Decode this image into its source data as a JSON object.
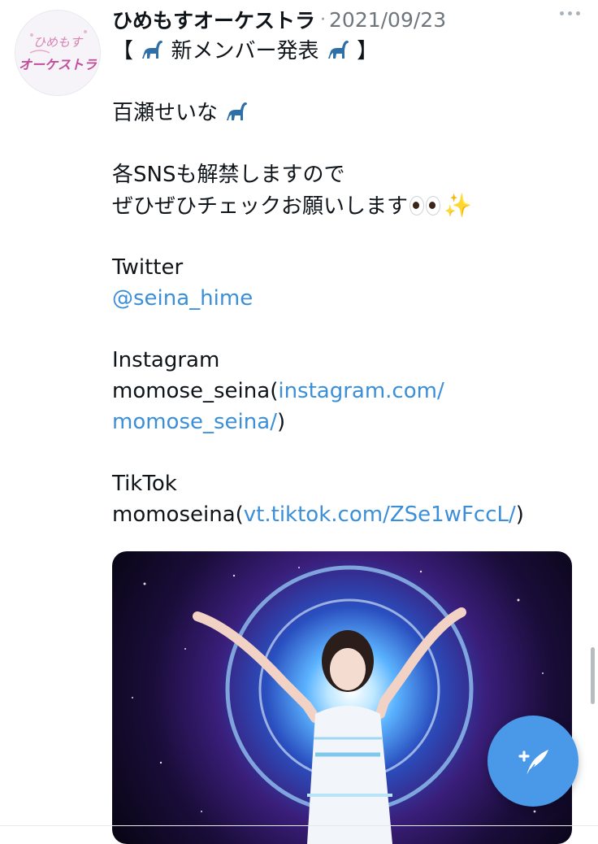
{
  "tweet": {
    "author_name": "ひめもすオーケストラ",
    "separator": "·",
    "date": "2021/09/23",
    "avatar_text": "ひめもす オーケストラ",
    "lines": {
      "title_pre": "【",
      "title": "新メンバー発表",
      "title_post": "】",
      "member": "百瀬せいな",
      "sns_line1": "各SNSも解禁しますので",
      "sns_line2": "ぜひぜひチェックお願いします",
      "twitter_label": "Twitter",
      "twitter_handle": "@seina_hime",
      "instagram_label": "Instagram",
      "instagram_user": "momose_seina(",
      "instagram_link1": "instagram.com/",
      "instagram_link2": "momose_seina/",
      "instagram_close": ")",
      "tiktok_label": "TikTok",
      "tiktok_user": "momoseina(",
      "tiktok_link": "vt.tiktok.com/ZSe1wFccL/",
      "tiktok_close": ")"
    }
  },
  "icons": {
    "more": "more-horizontal-icon",
    "compose": "compose-feather-icon",
    "dino": "sauropod-emoji",
    "eyes": "eyes-emoji",
    "sparkles": "sparkles-emoji"
  },
  "colors": {
    "link": "#3b8fd9",
    "fab": "#4a99e9",
    "secondary_text": "#6e767d"
  }
}
